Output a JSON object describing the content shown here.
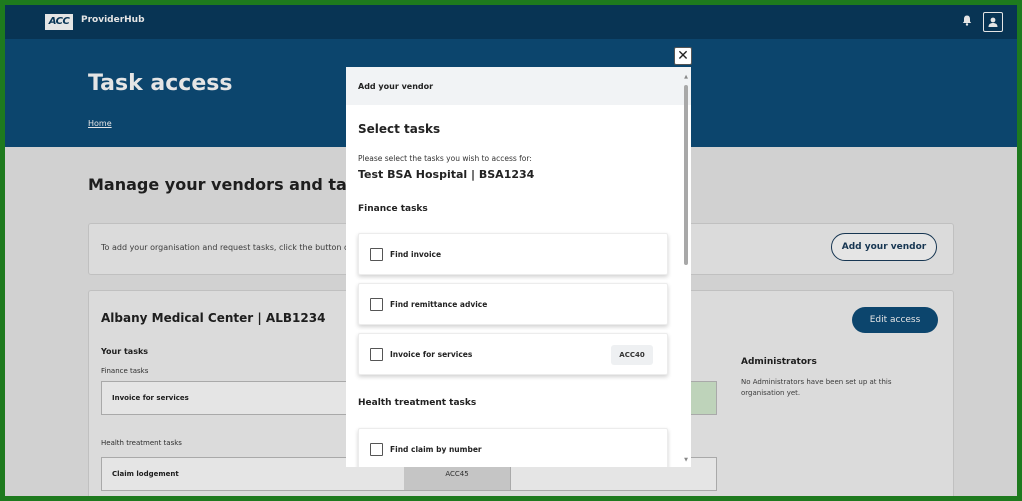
{
  "topbar": {
    "logo": "ACC",
    "brand": "ProviderHub",
    "bell_icon": "bell-icon",
    "user_icon": "user-icon"
  },
  "header": {
    "title": "Task access",
    "breadcrumb": "Home"
  },
  "main": {
    "section_title": "Manage your vendors and task acce",
    "info_text": "To add your organisation and request tasks, click the button on",
    "add_vendor_label": "Add your vendor",
    "org": {
      "name": "Albany Medical Center | ALB1234",
      "edit_label": "Edit access",
      "your_tasks_label": "Your tasks",
      "finance_label": "Finance tasks",
      "finance_task": "Invoice for services",
      "health_label": "Health treatment tasks",
      "health_task": "Claim lodgement",
      "health_code": "ACC45",
      "admins_title": "Administrators",
      "admins_text": "No Administrators have been set up at this organisation yet."
    }
  },
  "modal": {
    "header_title": "Add your vendor",
    "select_title": "Select tasks",
    "description": "Please select the tasks you wish to access for:",
    "hospital": "Test BSA Hospital | BSA1234",
    "finance_title": "Finance tasks",
    "finance_items": [
      {
        "label": "Find invoice",
        "badge": ""
      },
      {
        "label": "Find remittance advice",
        "badge": ""
      },
      {
        "label": "Invoice for services",
        "badge": "ACC40"
      }
    ],
    "health_title": "Health treatment tasks",
    "health_items": [
      {
        "label": "Find claim by number",
        "badge": ""
      }
    ],
    "close_label": "✕"
  },
  "colors": {
    "navbar": "#0a3a5e",
    "header": "#0e4d7a",
    "frame": "#1e7a1e"
  }
}
